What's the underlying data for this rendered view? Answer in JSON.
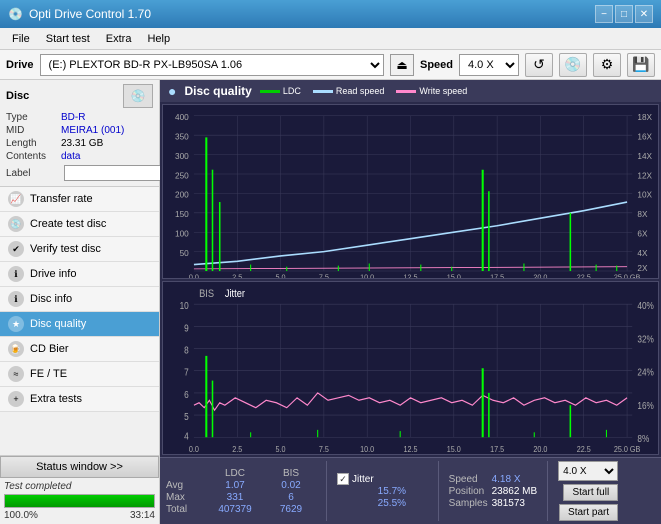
{
  "app": {
    "title": "Opti Drive Control 1.70",
    "icon": "💿"
  },
  "titlebar": {
    "minimize": "−",
    "maximize": "□",
    "close": "✕"
  },
  "menubar": {
    "items": [
      "File",
      "Start test",
      "Extra",
      "Help"
    ]
  },
  "drivebar": {
    "label": "Drive",
    "drive_value": "(E:)  PLEXTOR BD-R  PX-LB950SA 1.06",
    "speed_label": "Speed",
    "speed_value": "4.0 X",
    "eject_icon": "⏏"
  },
  "disc": {
    "title": "Disc",
    "type_label": "Type",
    "type_value": "BD-R",
    "mid_label": "MID",
    "mid_value": "MEIRA1 (001)",
    "length_label": "Length",
    "length_value": "23.31 GB",
    "contents_label": "Contents",
    "contents_value": "data",
    "label_label": "Label",
    "label_value": ""
  },
  "nav": {
    "items": [
      {
        "id": "transfer-rate",
        "label": "Transfer rate",
        "active": false
      },
      {
        "id": "create-test-disc",
        "label": "Create test disc",
        "active": false
      },
      {
        "id": "verify-test-disc",
        "label": "Verify test disc",
        "active": false
      },
      {
        "id": "drive-info",
        "label": "Drive info",
        "active": false
      },
      {
        "id": "disc-info",
        "label": "Disc info",
        "active": false
      },
      {
        "id": "disc-quality",
        "label": "Disc quality",
        "active": true
      },
      {
        "id": "cd-bier",
        "label": "CD Bier",
        "active": false
      },
      {
        "id": "fe-te",
        "label": "FE / TE",
        "active": false
      },
      {
        "id": "extra-tests",
        "label": "Extra tests",
        "active": false
      }
    ]
  },
  "chart": {
    "title": "Disc quality",
    "icon": "●",
    "legend": {
      "ldc_label": "LDC",
      "ldc_color": "#00cc00",
      "read_speed_label": "Read speed",
      "read_speed_color": "#aaddff",
      "write_speed_label": "Write speed",
      "write_speed_color": "#ff88cc"
    },
    "top_chart": {
      "y_max": 400,
      "y_right_labels": [
        "18X",
        "16X",
        "14X",
        "12X",
        "10X",
        "8X",
        "6X",
        "4X",
        "2X"
      ],
      "x_labels": [
        "0.0",
        "2.5",
        "5.0",
        "7.5",
        "10.0",
        "12.5",
        "15.0",
        "17.5",
        "20.0",
        "22.5",
        "25.0 GB"
      ]
    },
    "bottom_chart": {
      "title_ldc": "BIS",
      "title_jitter": "Jitter",
      "y_max": 10,
      "y_right_labels": [
        "40%",
        "32%",
        "24%",
        "16%",
        "8%"
      ],
      "x_labels": [
        "0.0",
        "2.5",
        "5.0",
        "7.5",
        "10.0",
        "12.5",
        "15.0",
        "17.5",
        "20.0",
        "22.5",
        "25.0 GB"
      ]
    }
  },
  "stats": {
    "headers": {
      "ldc": "LDC",
      "bis": "BIS",
      "jitter_label": "Jitter",
      "speed_label": "Speed",
      "position_label": "Position"
    },
    "avg_label": "Avg",
    "max_label": "Max",
    "total_label": "Total",
    "avg_ldc": "1.07",
    "avg_bis": "0.02",
    "avg_jitter": "15.7%",
    "max_ldc": "331",
    "max_bis": "6",
    "max_jitter": "25.5%",
    "total_ldc": "407379",
    "total_bis": "7629",
    "speed_current": "4.18 X",
    "speed_select": "4.0 X",
    "position_val": "23862 MB",
    "samples_val": "381573",
    "start_full_label": "Start full",
    "start_part_label": "Start part",
    "jitter_checked": true
  },
  "statusbar": {
    "status_window_label": "Status window >>",
    "status_text": "Test completed",
    "progress_pct": 100,
    "progress_display": "100.0%",
    "time_display": "33:14"
  }
}
